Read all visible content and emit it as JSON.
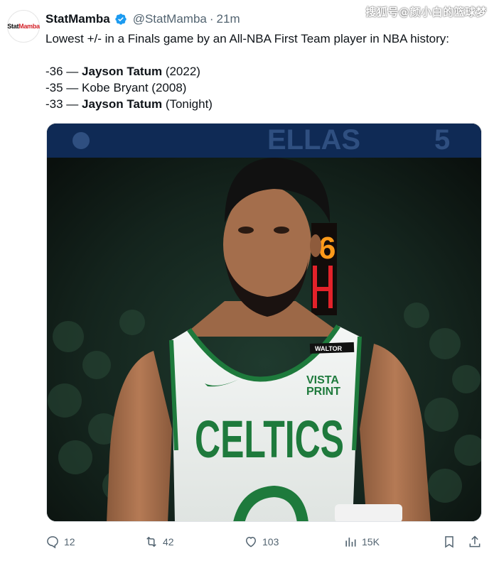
{
  "tweet": {
    "avatar_text_a": "Stat",
    "avatar_text_b": "Mamba",
    "display_name": "StatMamba",
    "handle": "@StatMamba",
    "separator": "·",
    "time": "21m",
    "watermark": "搜狐号@颜小白的篮球梦",
    "lines": {
      "intro": "Lowest +/- in a Finals game by an All-NBA First Team player in NBA history:",
      "l1_value": "-36 — ",
      "l1_name": "Jayson Tatum",
      "l1_note": " (2022)",
      "l2": "-35 — Kobe Bryant (2008)",
      "l3_value": "-33 — ",
      "l3_name": "Jayson Tatum",
      "l3_note": " (Tonight)"
    },
    "photo": {
      "arena_text": "ELLAS",
      "arena_number": "5",
      "shot_clock": "6",
      "jersey_text": "CELTICS",
      "jersey_sponsor_1": "VISTA",
      "jersey_sponsor_2": "PRINT",
      "collar_tag": "WALTOR"
    },
    "actions": {
      "replies": "12",
      "retweets": "42",
      "likes": "103",
      "views": "15K"
    }
  },
  "colors": {
    "verified_blue": "#1d9bf0",
    "text_secondary": "#536471",
    "celtics_green": "#1e7a3c"
  }
}
